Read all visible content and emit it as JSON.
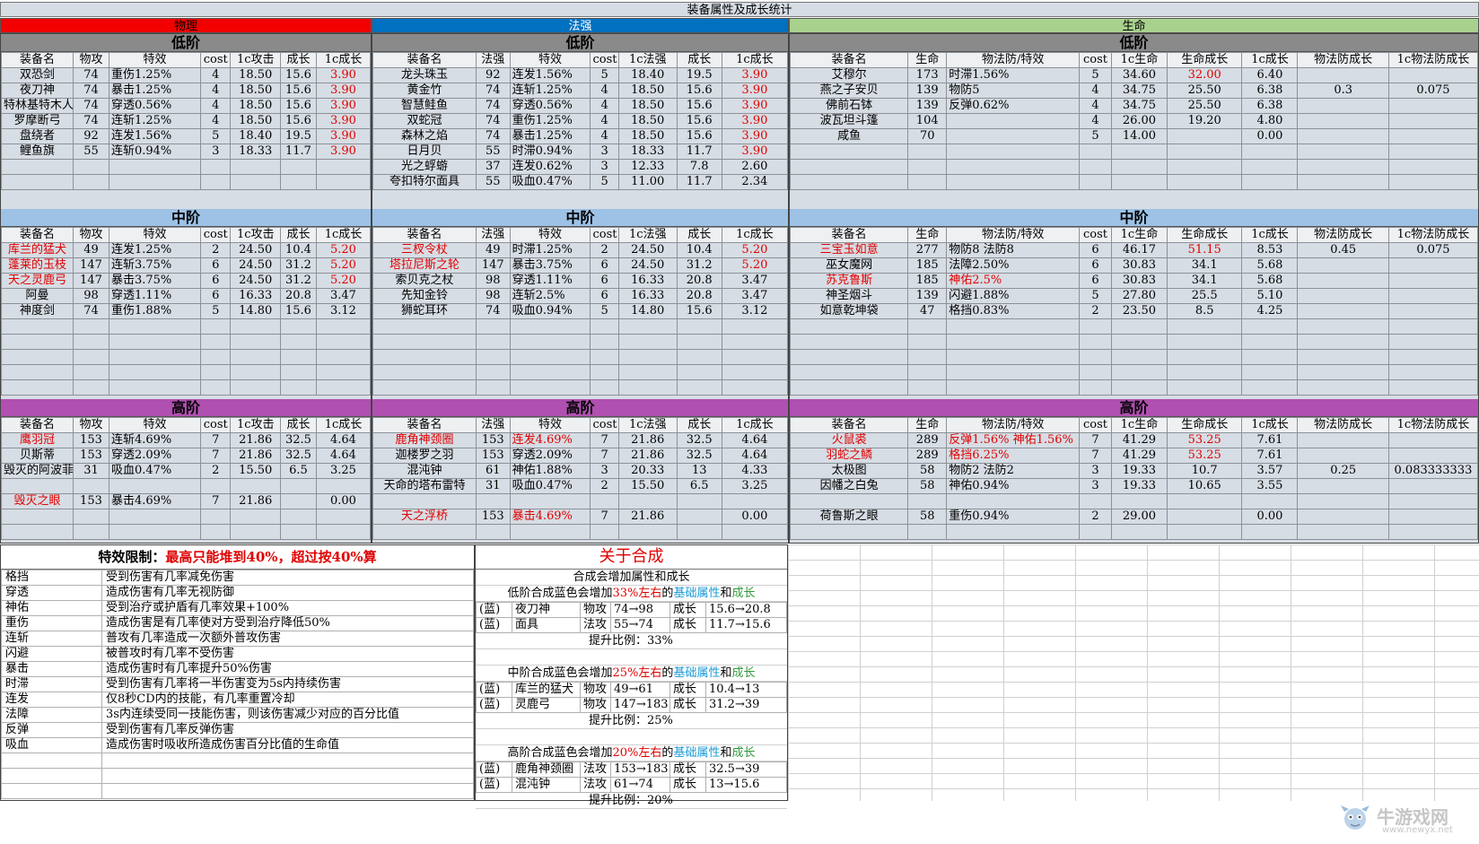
{
  "title": "装备属性及成长统计",
  "categories": {
    "phys": "物理",
    "magic": "法强",
    "life": "生命"
  },
  "colors": {
    "phys": "#f30000",
    "magic": "#0070c0",
    "life": "#a9d18e",
    "low": "#8a8a8a",
    "mid": "#9dc2e6",
    "high": "#b050b0",
    "accent_red": "#e00000",
    "accent_blue": "#1a9ad6",
    "accent_green": "#2e9a3a"
  },
  "tiers": {
    "low": "低阶",
    "mid": "中阶",
    "high": "高阶"
  },
  "headers": {
    "phys": [
      "装备名",
      "物攻",
      "特效",
      "cost",
      "1c攻击",
      "成长",
      "1c成长"
    ],
    "magic": [
      "装备名",
      "法强",
      "特效",
      "cost",
      "1c法强",
      "成长",
      "1c成长"
    ],
    "life": [
      "装备名",
      "生命",
      "物法防/特效",
      "cost",
      "1c生命",
      "生命成长",
      "1c成长",
      "物法防成长",
      "1c物法防成长"
    ]
  },
  "phys": {
    "low": [
      [
        "双恐剑",
        "74",
        "重伤1.25%",
        "4",
        "18.50",
        "15.6",
        "3.90"
      ],
      [
        "夜刀神",
        "74",
        "暴击1.25%",
        "4",
        "18.50",
        "15.6",
        "3.90"
      ],
      [
        "特林基特木人",
        "74",
        "穿透0.56%",
        "4",
        "18.50",
        "15.6",
        "3.90"
      ],
      [
        "罗摩断弓",
        "74",
        "连斩1.25%",
        "4",
        "18.50",
        "15.6",
        "3.90"
      ],
      [
        "盘绕者",
        "92",
        "连发1.56%",
        "5",
        "18.40",
        "19.5",
        "3.90"
      ],
      [
        "鲤鱼旗",
        "55",
        "连斩0.94%",
        "3",
        "18.33",
        "11.7",
        "3.90"
      ]
    ],
    "mid": [
      [
        "库兰的猛犬",
        "49",
        "连发1.25%",
        "2",
        "24.50",
        "10.4",
        "5.20"
      ],
      [
        "蓬莱的玉枝",
        "147",
        "连斩3.75%",
        "6",
        "24.50",
        "31.2",
        "5.20"
      ],
      [
        "天之灵鹿弓",
        "147",
        "暴击3.75%",
        "6",
        "24.50",
        "31.2",
        "5.20"
      ],
      [
        "阿曼",
        "98",
        "穿透1.11%",
        "6",
        "16.33",
        "20.8",
        "3.47"
      ],
      [
        "神度剑",
        "74",
        "重伤1.88%",
        "5",
        "14.80",
        "15.6",
        "3.12"
      ]
    ],
    "high": [
      [
        "鹰羽冠",
        "153",
        "连斩4.69%",
        "7",
        "21.86",
        "32.5",
        "4.64"
      ],
      [
        "贝斯蒂",
        "153",
        "穿透2.09%",
        "7",
        "21.86",
        "32.5",
        "4.64"
      ],
      [
        "毁灭的阿波菲斯",
        "31",
        "吸血0.47%",
        "2",
        "15.50",
        "6.5",
        "3.25"
      ],
      [
        "",
        "",
        "",
        "",
        "",
        "",
        ""
      ],
      [
        "毁灭之眼",
        "153",
        "暴击4.69%",
        "7",
        "21.86",
        "",
        "0.00"
      ]
    ]
  },
  "magic": {
    "low": [
      [
        "龙头珠玉",
        "92",
        "连发1.56%",
        "5",
        "18.40",
        "19.5",
        "3.90"
      ],
      [
        "黄金竹",
        "74",
        "连斩1.25%",
        "4",
        "18.50",
        "15.6",
        "3.90"
      ],
      [
        "智慧鲑鱼",
        "74",
        "穿透0.56%",
        "4",
        "18.50",
        "15.6",
        "3.90"
      ],
      [
        "双蛇冠",
        "74",
        "重伤1.25%",
        "4",
        "18.50",
        "15.6",
        "3.90"
      ],
      [
        "森林之焰",
        "74",
        "暴击1.25%",
        "4",
        "18.50",
        "15.6",
        "3.90"
      ],
      [
        "日月贝",
        "55",
        "时滞0.94%",
        "3",
        "18.33",
        "11.7",
        "3.90"
      ],
      [
        "光之蜉蝣",
        "37",
        "连发0.62%",
        "3",
        "12.33",
        "7.8",
        "2.60"
      ],
      [
        "夸扣特尔面具",
        "55",
        "吸血0.47%",
        "5",
        "11.00",
        "11.7",
        "2.34"
      ]
    ],
    "mid": [
      [
        "三杈令杖",
        "49",
        "时滞1.25%",
        "2",
        "24.50",
        "10.4",
        "5.20"
      ],
      [
        "塔拉尼斯之轮",
        "147",
        "暴击3.75%",
        "6",
        "24.50",
        "31.2",
        "5.20"
      ],
      [
        "索贝克之杖",
        "98",
        "穿透1.11%",
        "6",
        "16.33",
        "20.8",
        "3.47"
      ],
      [
        "先知金铃",
        "98",
        "连斩2.5%",
        "6",
        "16.33",
        "20.8",
        "3.47"
      ],
      [
        "狮蛇耳环",
        "74",
        "吸血0.94%",
        "5",
        "14.80",
        "15.6",
        "3.12"
      ]
    ],
    "high": [
      [
        "鹿角神颈圈",
        "153",
        "连发4.69%",
        "7",
        "21.86",
        "32.5",
        "4.64"
      ],
      [
        "迦楼罗之羽",
        "153",
        "穿透2.09%",
        "7",
        "21.86",
        "32.5",
        "4.64"
      ],
      [
        "混沌钟",
        "61",
        "神佑1.88%",
        "3",
        "20.33",
        "13",
        "4.33"
      ],
      [
        "天命的塔布雷特",
        "31",
        "吸血0.47%",
        "2",
        "15.50",
        "6.5",
        "3.25"
      ],
      [
        "",
        "",
        "",
        "",
        "",
        "",
        ""
      ],
      [
        "天之浮桥",
        "153",
        "暴击4.69%",
        "7",
        "21.86",
        "",
        "0.00"
      ]
    ]
  },
  "life": {
    "low": [
      [
        "艾穆尔",
        "173",
        "时滞1.56%",
        "5",
        "34.60",
        "32.00",
        "6.40",
        "",
        ""
      ],
      [
        "燕之子安贝",
        "139",
        "物防5",
        "4",
        "34.75",
        "25.50",
        "6.38",
        "0.3",
        "0.075"
      ],
      [
        "佛前石钵",
        "139",
        "反弹0.62%",
        "4",
        "34.75",
        "25.50",
        "6.38",
        "",
        ""
      ],
      [
        "波瓦坦斗篷",
        "104",
        "",
        "4",
        "26.00",
        "19.20",
        "4.80",
        "",
        ""
      ],
      [
        "咸鱼",
        "70",
        "",
        "5",
        "14.00",
        "",
        "0.00",
        "",
        ""
      ]
    ],
    "mid": [
      [
        "三宝玉如意",
        "277",
        "物防8 法防8",
        "6",
        "46.17",
        "51.15",
        "8.53",
        "0.45",
        "0.075"
      ],
      [
        "巫女魔网",
        "185",
        "法障2.50%",
        "6",
        "30.83",
        "34.1",
        "5.68",
        "",
        ""
      ],
      [
        "苏克鲁斯",
        "185",
        "神佑2.5%",
        "6",
        "30.83",
        "34.1",
        "5.68",
        "",
        ""
      ],
      [
        "神圣烟斗",
        "139",
        "闪避1.88%",
        "5",
        "27.80",
        "25.5",
        "5.10",
        "",
        ""
      ],
      [
        "如意乾坤袋",
        "47",
        "格挡0.83%",
        "2",
        "23.50",
        "8.5",
        "4.25",
        "",
        ""
      ]
    ],
    "high": [
      [
        "火鼠裘",
        "289",
        "反弹1.56% 神佑1.56%",
        "7",
        "41.29",
        "53.25",
        "7.61",
        "",
        ""
      ],
      [
        "羽蛇之鳞",
        "289",
        "格挡6.25%",
        "7",
        "41.29",
        "53.25",
        "7.61",
        "",
        ""
      ],
      [
        "太极图",
        "58",
        "物防2 法防2",
        "3",
        "19.33",
        "10.7",
        "3.57",
        "0.25",
        "0.083333333"
      ],
      [
        "因幡之白兔",
        "58",
        "神佑0.94%",
        "3",
        "19.33",
        "10.65",
        "3.55",
        "",
        ""
      ],
      [
        "",
        "",
        "",
        "",
        "",
        "",
        "",
        "",
        ""
      ],
      [
        "荷鲁斯之眼",
        "58",
        "重伤0.94%",
        "2",
        "29.00",
        "",
        "0.00",
        "",
        ""
      ]
    ]
  },
  "limits": {
    "title_prefix": "特效限制：",
    "title_red": "最高只能堆到40%，超过按40%算",
    "rows": [
      [
        "格挡",
        "受到伤害有几率减免伤害"
      ],
      [
        "穿透",
        "造成伤害有几率无视防御"
      ],
      [
        "神佑",
        "受到治疗或护盾有几率效果+100%"
      ],
      [
        "重伤",
        "造成伤害是有几率使对方受到治疗降低50%"
      ],
      [
        "连斩",
        "普攻有几率造成一次额外普攻伤害"
      ],
      [
        "闪避",
        "被普攻时有几率不受伤害"
      ],
      [
        "暴击",
        "造成伤害时有几率提升50%伤害"
      ],
      [
        "时滞",
        "受到伤害有几率将一半伤害变为5s内持续伤害"
      ],
      [
        "连发",
        "仅8秒CD内的技能，有几率重置冷却"
      ],
      [
        "法障",
        "3s内连续受同一技能伤害，则该伤害减少对应的百分比值"
      ],
      [
        "反弹",
        "受到伤害有几率反弹伤害"
      ],
      [
        "吸血",
        "造成伤害时吸收所造成伤害百分比值的生命值"
      ],
      [
        "",
        ""
      ],
      [
        "",
        ""
      ],
      [
        "",
        ""
      ]
    ]
  },
  "synthesis": {
    "title": "关于合成",
    "intro": "合成会增加属性和成长",
    "sections": [
      {
        "pre": "低阶合成蓝色会增加",
        "pct": "33%左右",
        "mid": "的",
        "base": "基础属性",
        "and": "和",
        "growth": "成长",
        "rows": [
          [
            "(蓝)",
            "夜刀神",
            "物攻",
            "74→98",
            "成长",
            "15.6→20.8"
          ],
          [
            "(蓝)",
            "面具",
            "法攻",
            "55→74",
            "成长",
            "11.7→15.6"
          ]
        ],
        "ratio": "提升比例：33%"
      },
      {
        "pre": "中阶合成蓝色会增加",
        "pct": "25%左右",
        "mid": "的",
        "base": "基础属性",
        "and": "和",
        "growth": "成长",
        "rows": [
          [
            "(蓝)",
            "库兰的猛犬",
            "物攻",
            "49→61",
            "成长",
            "10.4→13"
          ],
          [
            "(蓝)",
            "灵鹿弓",
            "物攻",
            "147→183",
            "成长",
            "31.2→39"
          ]
        ],
        "ratio": "提升比例：25%"
      },
      {
        "pre": "高阶合成蓝色会增加",
        "pct": "20%左右",
        "mid": "的",
        "base": "基础属性",
        "and": "和",
        "growth": "成长",
        "rows": [
          [
            "(蓝)",
            "鹿角神颈圈",
            "法攻",
            "153→183",
            "成长",
            "32.5→39"
          ],
          [
            "(蓝)",
            "混沌钟",
            "法攻",
            "61→74",
            "成长",
            "13→15.6"
          ]
        ],
        "ratio": "提升比例：20%"
      }
    ]
  },
  "watermark": {
    "text": "牛游戏网",
    "url": "www.newyx.net"
  }
}
